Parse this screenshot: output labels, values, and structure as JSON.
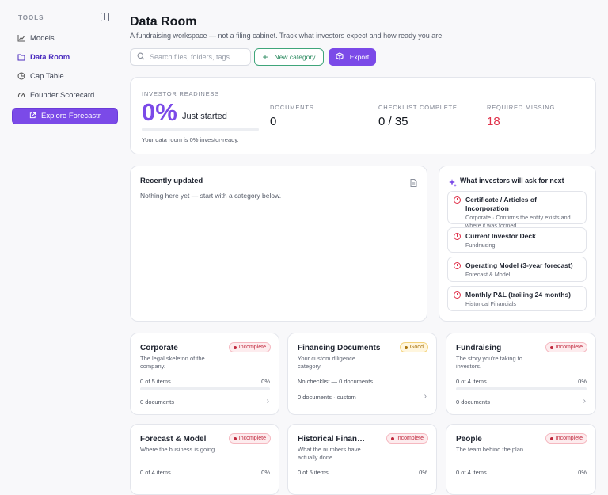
{
  "sidebar": {
    "section_label": "TOOLS",
    "items": [
      {
        "label": "Models",
        "icon": "chart-line-icon"
      },
      {
        "label": "Data Room",
        "icon": "folder-icon",
        "active": true
      },
      {
        "label": "Cap Table",
        "icon": "pie-chart-icon"
      },
      {
        "label": "Founder Scorecard",
        "icon": "gauge-icon"
      }
    ],
    "explore_label": "Explore Forecastr"
  },
  "header": {
    "title": "Data Room",
    "subtitle": "A fundraising workspace — not a filing cabinet. Track what investors expect and how ready you are."
  },
  "toolbar": {
    "search_placeholder": "Search files, folders, tags...",
    "new_category_label": "New category",
    "export_label": "Export"
  },
  "readiness": {
    "label": "INVESTOR READINESS",
    "percent": "0%",
    "status": "Just started",
    "progress_fraction": 0,
    "note": "Your data room is 0% investor-ready.",
    "stats": [
      {
        "label": "DOCUMENTS",
        "value": "0"
      },
      {
        "label": "CHECKLIST COMPLETE",
        "value": "0 / 35"
      },
      {
        "label": "REQUIRED MISSING",
        "value": "18"
      }
    ]
  },
  "recent": {
    "title": "Recently updated",
    "empty": "Nothing here yet — start with a category below."
  },
  "asks": {
    "title": "What investors will ask for next",
    "items": [
      {
        "title": "Certificate / Articles of Incorporation",
        "sub": "Corporate · Confirms the entity exists and where it was formed."
      },
      {
        "title": "Current Investor Deck",
        "sub": "Fundraising"
      },
      {
        "title": "Operating Model (3-year forecast)",
        "sub": "Forecast & Model"
      },
      {
        "title": "Monthly P&L (trailing 24 months)",
        "sub": "Historical Financials"
      }
    ]
  },
  "categories": [
    {
      "title": "Corporate",
      "badge": "Incomplete",
      "desc": "The legal skeleton of the company.",
      "items": "0 of 5 items",
      "pct": "0%",
      "docs": "0 documents"
    },
    {
      "title": "Financing Documents",
      "badge": "Good",
      "desc": "Your custom diligence category.",
      "items": "No checklist — 0 documents.",
      "pct": "",
      "docs": "0 documents · custom"
    },
    {
      "title": "Fundraising",
      "badge": "Incomplete",
      "desc": "The story you're taking to investors.",
      "items": "0 of 4 items",
      "pct": "0%",
      "docs": "0 documents"
    },
    {
      "title": "Forecast & Model",
      "badge": "Incomplete",
      "desc": "Where the business is going.",
      "items": "0 of 4 items",
      "pct": "0%",
      "docs": ""
    },
    {
      "title": "Historical Financials",
      "badge": "Incomplete",
      "desc": "What the numbers have actually done.",
      "items": "0 of 5 items",
      "pct": "0%",
      "docs": ""
    },
    {
      "title": "People",
      "badge": "Incomplete",
      "desc": "The team behind the plan.",
      "items": "0 of 4 items",
      "pct": "0%",
      "docs": ""
    }
  ],
  "colors": {
    "accent": "#7b4ae8",
    "danger": "#e0314a",
    "success": "#2a8a5f",
    "warning": "#a9720a"
  }
}
